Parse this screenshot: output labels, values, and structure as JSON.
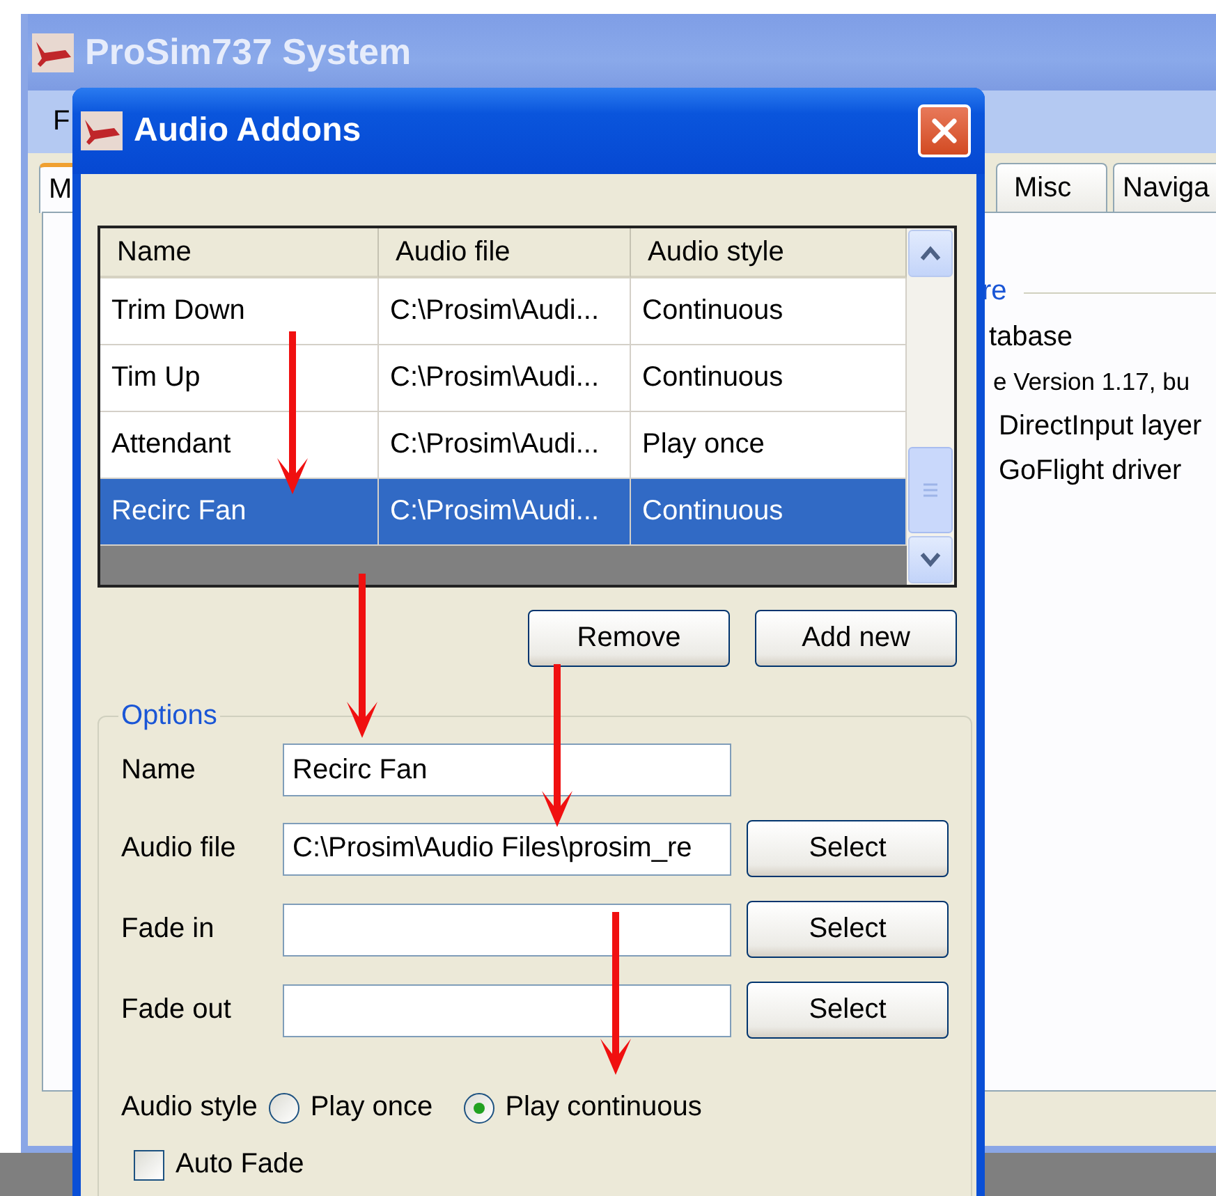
{
  "background_window": {
    "title": "ProSim737 System",
    "menu": [
      "F"
    ],
    "tabs": [
      {
        "label": "M",
        "selected": true
      },
      {
        "label": "Misc",
        "selected": false
      },
      {
        "label": "Naviga",
        "selected": false
      }
    ],
    "group_title": "re",
    "lines": [
      "tabase",
      "e Version 1.17, bu",
      "DirectInput layer",
      "GoFlight driver"
    ]
  },
  "dialog": {
    "title": "Audio Addons",
    "table": {
      "columns": [
        "Name",
        "Audio file",
        "Audio style"
      ],
      "rows": [
        {
          "cells": [
            "Trim Down",
            "C:\\Prosim\\Audi...",
            "Continuous"
          ],
          "selected": false
        },
        {
          "cells": [
            "Tim Up",
            "C:\\Prosim\\Audi...",
            "Continuous"
          ],
          "selected": false
        },
        {
          "cells": [
            "Attendant",
            "C:\\Prosim\\Audi...",
            "Play once"
          ],
          "selected": false
        },
        {
          "cells": [
            "Recirc Fan",
            "C:\\Prosim\\Audi...",
            "Continuous"
          ],
          "selected": true
        }
      ]
    },
    "buttons": [
      "Remove",
      "Add new"
    ],
    "options": {
      "title": "Options",
      "fields": [
        {
          "label": "Name",
          "value": "Recirc Fan"
        },
        {
          "label": "Audio file",
          "value": "C:\\Prosim\\Audio Files\\prosim_re",
          "button": "Select"
        },
        {
          "label": "Fade in",
          "button": "Select"
        },
        {
          "label": "Fade out",
          "button": "Select"
        }
      ],
      "audio_style": {
        "label": "Audio style",
        "options": [
          {
            "label": "Play once",
            "selected": false
          },
          {
            "label": "Play continuous",
            "selected": true
          }
        ]
      },
      "auto_fade": {
        "label": "Auto Fade",
        "checked": false
      }
    }
  }
}
